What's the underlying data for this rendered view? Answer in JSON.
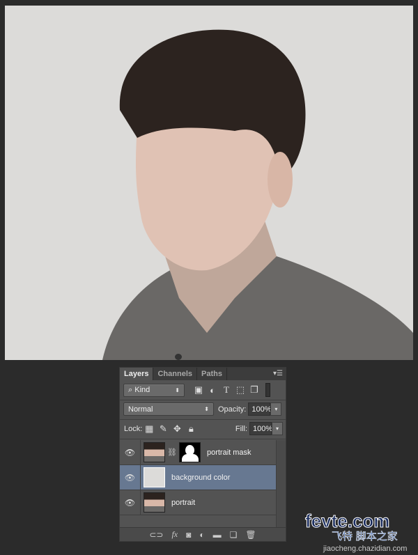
{
  "canvas": {
    "background_color": "#dcdbd9"
  },
  "panel": {
    "tabs": [
      {
        "label": "Layers",
        "active": true
      },
      {
        "label": "Channels"
      },
      {
        "label": "Paths"
      }
    ],
    "filter": {
      "value": "Kind",
      "icons": [
        "image-filter-icon",
        "adjustment-filter-icon",
        "type-filter-icon",
        "shape-filter-icon",
        "smart-object-filter-icon"
      ]
    },
    "blend_mode": "Normal",
    "opacity_label": "Opacity:",
    "opacity": "100%",
    "lock_label": "Lock:",
    "fill_label": "Fill:",
    "fill": "100%",
    "layers": [
      {
        "name": "portrait mask",
        "visible": true,
        "has_mask": true
      },
      {
        "name": "background color",
        "visible": true,
        "selected": true,
        "color": "#dcdbd9"
      },
      {
        "name": "portrait",
        "visible": true
      }
    ],
    "selected_color": "#677891"
  },
  "watermark": {
    "line1": "fevte.com",
    "line2": "飞特 脚本之家",
    "line3": "jiaocheng.chazidian.com"
  }
}
